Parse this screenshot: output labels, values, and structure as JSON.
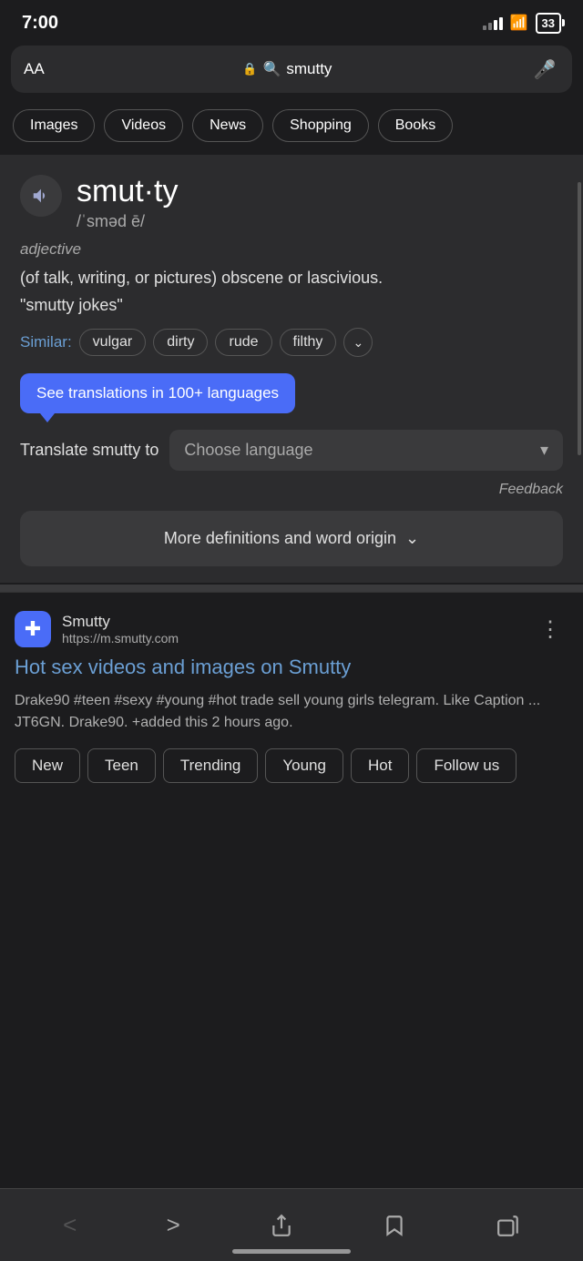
{
  "statusBar": {
    "time": "7:00",
    "battery": "33"
  },
  "searchBar": {
    "aa": "AA",
    "query": "smutty",
    "lock": "🔒"
  },
  "tabs": [
    {
      "label": "Images",
      "active": false
    },
    {
      "label": "Videos",
      "active": false
    },
    {
      "label": "News",
      "active": false
    },
    {
      "label": "Shopping",
      "active": false
    },
    {
      "label": "Books",
      "active": false
    }
  ],
  "dictionary": {
    "word": "smut·ty",
    "pronunciation": "/ˈsməd ē/",
    "partOfSpeech": "adjective",
    "definition": "(of talk, writing, or pictures) obscene or lascivious.",
    "example": "\"smutty jokes\"",
    "similar": {
      "label": "Similar:",
      "tags": [
        "vulgar",
        "dirty",
        "rude",
        "filthy"
      ]
    },
    "tooltip": "See translations in 100+ languages",
    "translateLabel": "Translate smutty to",
    "chooseLanguage": "Choose language",
    "feedback": "Feedback",
    "moreDefsLabel": "More definitions and word origin"
  },
  "result": {
    "siteName": "Smutty",
    "siteUrl": "https://m.smutty.com",
    "siteIconChar": "✚",
    "title": "Hot sex videos and images on Smutty",
    "snippet": "Drake90 #teen #sexy #young #hot trade sell young girls telegram. Like Caption ... JT6GN. Drake90. +added this 2 hours ago.",
    "tags": [
      "New",
      "Teen",
      "Trending",
      "Young",
      "Hot",
      "Follow us"
    ]
  },
  "nav": {
    "back": "‹",
    "forward": "›",
    "share": "⬆",
    "bookmarks": "□",
    "tabs": "⧉"
  }
}
